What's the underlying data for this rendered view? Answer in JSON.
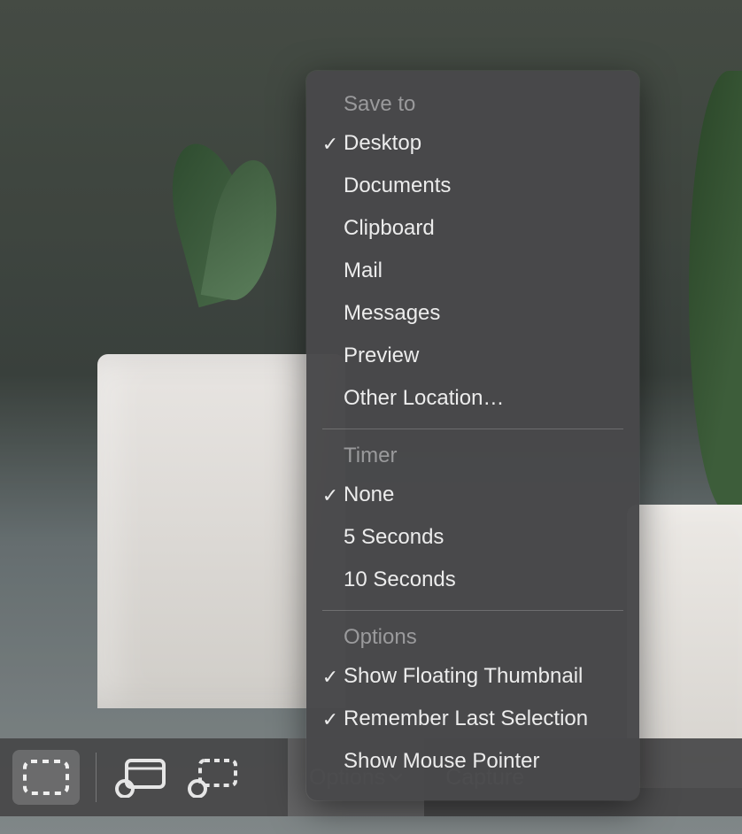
{
  "menu": {
    "sections": [
      {
        "header": "Save to",
        "items": [
          {
            "label": "Desktop",
            "checked": true
          },
          {
            "label": "Documents",
            "checked": false
          },
          {
            "label": "Clipboard",
            "checked": false
          },
          {
            "label": "Mail",
            "checked": false
          },
          {
            "label": "Messages",
            "checked": false
          },
          {
            "label": "Preview",
            "checked": false
          },
          {
            "label": "Other Location…",
            "checked": false
          }
        ]
      },
      {
        "header": "Timer",
        "items": [
          {
            "label": "None",
            "checked": true
          },
          {
            "label": "5 Seconds",
            "checked": false
          },
          {
            "label": "10 Seconds",
            "checked": false
          }
        ]
      },
      {
        "header": "Options",
        "items": [
          {
            "label": "Show Floating Thumbnail",
            "checked": true
          },
          {
            "label": "Remember Last Selection",
            "checked": true
          },
          {
            "label": "Show Mouse Pointer",
            "checked": false
          }
        ]
      }
    ]
  },
  "toolbar": {
    "options_label": "Options",
    "capture_label": "Capture"
  },
  "check_glyph": "✓"
}
